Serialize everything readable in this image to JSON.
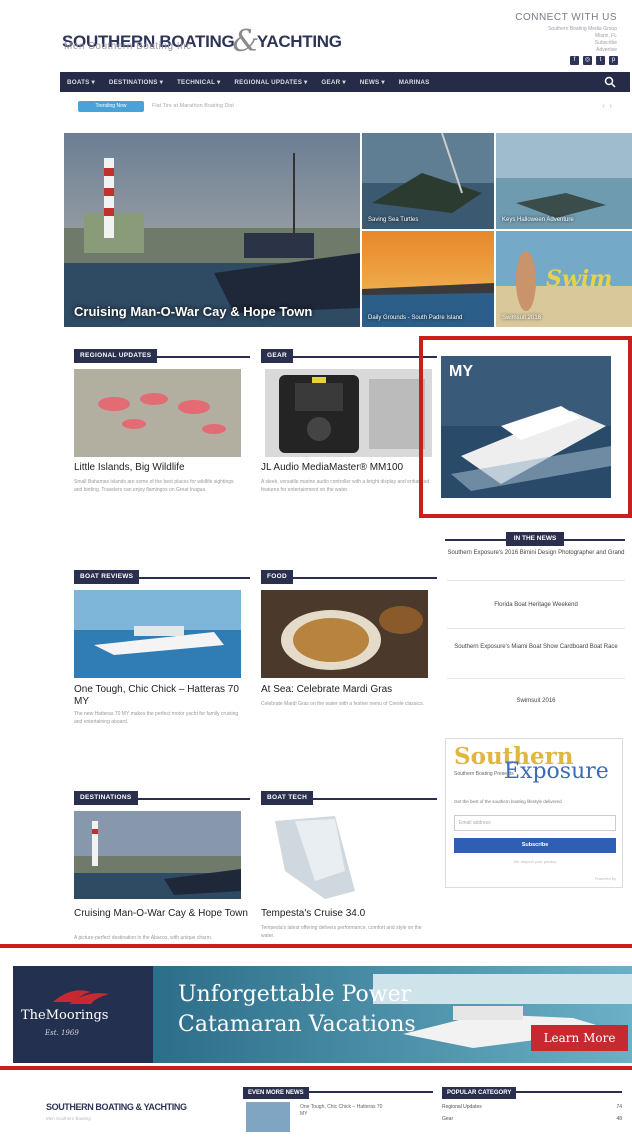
{
  "header": {
    "logo_left": "SOUTHERN BOATING",
    "logo_amp": "&",
    "logo_right": "YACHTING",
    "tagline": "Men Southern Boating Inc",
    "connect": "CONNECT WITH US",
    "contact_lines": [
      "Southern Boating Media Group",
      "Miami, FL",
      "Subscribe",
      "Advertise"
    ]
  },
  "nav": {
    "items": [
      "BOATS ▾",
      "DESTINATIONS ▾",
      "TECHNICAL ▾",
      "REGIONAL UPDATES ▾",
      "GEAR ▾",
      "NEWS ▾",
      "MARINAS"
    ]
  },
  "trending": {
    "label": "Trending Now",
    "text": "Flat Tire at Marathon Boating Dist"
  },
  "hero": {
    "main_caption": "Cruising Man-O-War Cay & Hope Town",
    "tiles": [
      "Saving Sea Turtles",
      "Keys Halloween Adventure",
      "Daily Grounds - South Padre Island",
      "Swimsuit 2016"
    ]
  },
  "sections": {
    "regional": "REGIONAL UPDATES",
    "gear": "GEAR",
    "boat_reviews": "BOAT REVIEWS",
    "food": "FOOD",
    "destinations": "DESTINATIONS",
    "boat_tech": "BOAT TECH"
  },
  "articles": {
    "regional": {
      "title": "Little Islands, Big Wildlife",
      "excerpt": "Small Bahamas islands are some of the best places for wildlife sightings and birding. Travelers can enjoy flamingos on Great Inagua."
    },
    "gear": {
      "title": "JL Audio MediaMaster® MM100",
      "excerpt": "A sleek, versatile marine audio controller with a bright display and enhanced features for entertainment on the water."
    },
    "boat_reviews": {
      "title": "One Tough, Chic Chick – Hatteras 70 MY",
      "excerpt": "The new Hatteras 70 MY makes the perfect motor yacht for family cruising and entertaining aboard."
    },
    "food": {
      "title": "At Sea: Celebrate Mardi Gras",
      "excerpt": "Celebrate Mardi Gras on the water with a festive menu of Creole classics."
    },
    "destinations": {
      "title": "Cruising Man-O-War Cay & Hope Town",
      "excerpt": "A picture-perfect destination in the Abacos, with unique charm."
    },
    "boat_tech": {
      "title": "Tempesta's Cruise 34.0",
      "excerpt": "Tempesta's latest offering delivers performance, comfort and style on the water."
    }
  },
  "sidebar": {
    "ad_badge": "MY",
    "in_the_news_label": "IN THE NEWS",
    "news": [
      "Southern Exposure's 2016 Bimini Design Photographer and Grand",
      "Florida Boat Heritage Weekend",
      "Southern Exposure's Miami Boat Show Cardboard Boat Race",
      "Swimsuit 2016"
    ],
    "southern_exposure": {
      "logo1": "Southern",
      "logo2": "Exposure",
      "small": "Southern Boating Presents",
      "desc": "Get the best of the southern boating lifestyle delivered",
      "placeholder": "Email address",
      "button": "Subscribe",
      "fine": "We respect your privacy",
      "powered": "Powered by"
    }
  },
  "banner": {
    "brand": "TheMoorings",
    "est": "Est. 1969",
    "line1": "Unforgettable Power",
    "line2": "Catamaran Vacations",
    "cta": "Learn More"
  },
  "footer": {
    "logo": "SOUTHERN BOATING & YACHTING",
    "tagline": "Men Southern Boating",
    "even_more": "EVEN MORE NEWS",
    "news_title": "One Tough, Chic Chick – Hatteras 70 MY",
    "popular": "POPULAR CATEGORY",
    "categories": [
      {
        "name": "Regional Updates",
        "count": "74"
      },
      {
        "name": "Gear",
        "count": "48"
      }
    ]
  },
  "colors": {
    "navy": "#262c48",
    "accent_blue": "#4aa3d8",
    "ad_red": "#c81e1e"
  }
}
